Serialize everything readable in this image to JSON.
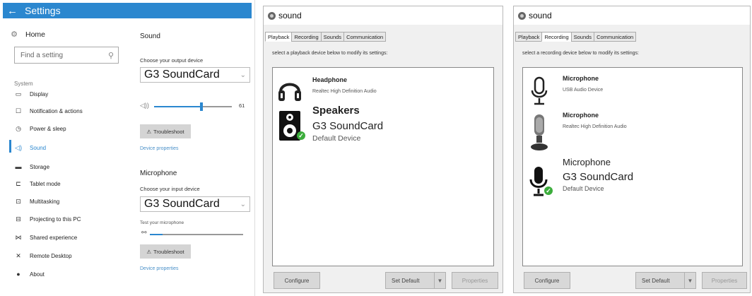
{
  "settings": {
    "title": "Settings",
    "home": "Home",
    "search_placeholder": "Find a setting",
    "section_label": "System",
    "nav": [
      {
        "label": "Display",
        "icon": "monitor-icon",
        "glyph": "▭"
      },
      {
        "label": "Notification & actions",
        "icon": "notification-icon",
        "glyph": "☐"
      },
      {
        "label": "Power & sleep",
        "icon": "power-icon",
        "glyph": "◷"
      },
      {
        "label": "Sound",
        "icon": "speaker-icon",
        "glyph": "◁)"
      },
      {
        "label": "Storage",
        "icon": "storage-icon",
        "glyph": "▬"
      },
      {
        "label": "Tablet mode",
        "icon": "tablet-icon",
        "glyph": "⊏"
      },
      {
        "label": "Multitasking",
        "icon": "multitasking-icon",
        "glyph": "⊡"
      },
      {
        "label": "Projecting to this PC",
        "icon": "projecting-icon",
        "glyph": "⊟"
      },
      {
        "label": "Shared experience",
        "icon": "shared-icon",
        "glyph": "⋈"
      },
      {
        "label": "Remote Desktop",
        "icon": "remote-icon",
        "glyph": "✕"
      },
      {
        "label": "About",
        "icon": "about-icon",
        "glyph": "●"
      }
    ],
    "sound": {
      "heading": "Sound",
      "output_label": "Choose your output device",
      "output_device": "G3 SoundCard",
      "volume": 61,
      "volume_text": "61",
      "troubleshoot": "Troubleshoot",
      "device_properties": "Device properties",
      "mic_heading": "Microphone",
      "input_label": "Choose your input device",
      "input_device": "G3 SoundCard",
      "test_label": "Test your microphone",
      "mic_level": 0.14,
      "troubleshoot2": "Troubleshoot",
      "device_properties2": "Device properties"
    }
  },
  "playback": {
    "title": "sound",
    "tabs": [
      "Playback",
      "Recording",
      "Sounds",
      "Communication"
    ],
    "selected_tab": "Playback",
    "instruction": "select a playback device below to modify its settings:",
    "devices": [
      {
        "name": "Headphone",
        "sub": "Realtec High Definition Audio",
        "status": "",
        "icon": "headphone-icon"
      },
      {
        "name": "Speakers",
        "sub": "G3 SoundCard",
        "status": "Default Device",
        "icon": "speaker-icon"
      }
    ],
    "buttons": {
      "configure": "Configure",
      "set_default": "Set Default",
      "properties": "Properties"
    }
  },
  "recording": {
    "title": "sound",
    "tabs": [
      "Playback",
      "Recording",
      "Sounds",
      "Communication"
    ],
    "selected_tab": "Recording",
    "instruction": "select a recording device below to modify its settings:",
    "devices": [
      {
        "name": "Microphone",
        "sub": "USB Audio Device",
        "status": "",
        "icon": "usb-microphone-icon"
      },
      {
        "name": "Microphone",
        "sub": "Realtec High Definition Audio",
        "status": "",
        "icon": "studio-microphone-icon"
      },
      {
        "name": "Microphone",
        "sub": "G3 SoundCard",
        "status": "Default Device",
        "icon": "microphone-icon"
      }
    ],
    "buttons": {
      "configure": "Configure",
      "set_default": "Set Default",
      "properties": "Properties"
    }
  }
}
